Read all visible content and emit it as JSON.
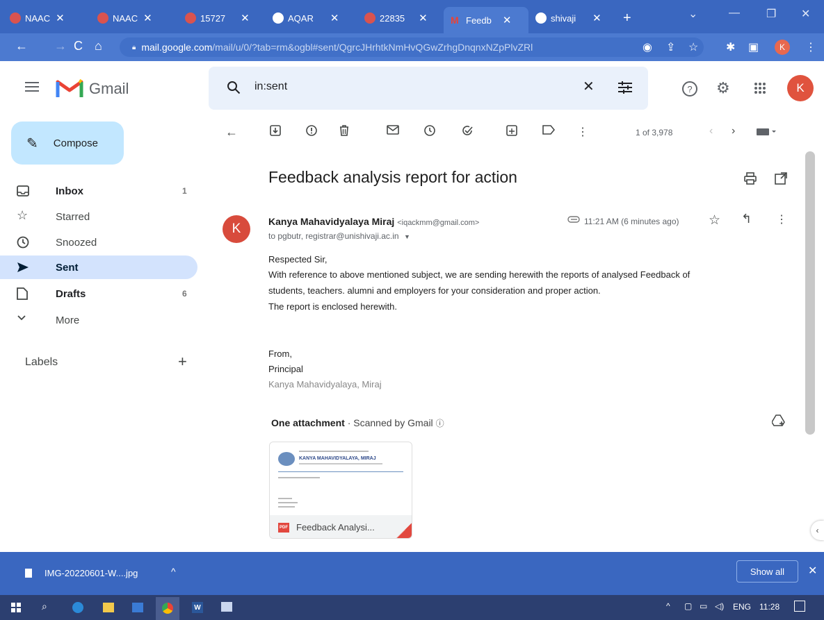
{
  "browser": {
    "tabs": [
      {
        "title": "NAAC",
        "favicon_color": "#d9534f"
      },
      {
        "title": "NAAC",
        "favicon_color": "#d9534f"
      },
      {
        "title": "15727",
        "favicon_color": "#d9534f"
      },
      {
        "title": "AQAR",
        "favicon_color": "#ffffff"
      },
      {
        "title": "22835",
        "favicon_color": "#d9534f"
      },
      {
        "title": "Feedb",
        "favicon_color": "#ea4335",
        "active": true
      },
      {
        "title": "shivaji",
        "favicon_color": "#ffffff"
      }
    ],
    "new_tab_label": "+",
    "url_host": "mail.google.com",
    "url_path": "/mail/u/0/?tab=rm&ogbl#sent/QgrcJHrhtkNmHvQGwZrhgDnqnxNZpPlvZRl",
    "profile_initial": "K",
    "accent": "#3a67c0"
  },
  "gmail": {
    "logo_text": "Gmail",
    "search_value": "in:sent",
    "account_initial": "K",
    "compose_label": "Compose",
    "nav": [
      {
        "label": "Inbox",
        "count": "1",
        "icon": "inbox-icon",
        "bold": true
      },
      {
        "label": "Starred",
        "count": "",
        "icon": "star-icon"
      },
      {
        "label": "Snoozed",
        "count": "",
        "icon": "clock-icon"
      },
      {
        "label": "Sent",
        "count": "",
        "icon": "send-icon",
        "active": true
      },
      {
        "label": "Drafts",
        "count": "6",
        "icon": "draft-icon",
        "bold": true
      },
      {
        "label": "More",
        "count": "",
        "icon": "chevron-down-icon"
      }
    ],
    "labels_heading": "Labels",
    "pager": "1 of 3,978"
  },
  "message": {
    "subject": "Feedback analysis report for action",
    "sender_initial": "K",
    "sender_name": "Kanya Mahavidyalaya Miraj",
    "sender_email": "<iqackmm@gmail.com>",
    "to": "to pgbutr, registrar@unishivaji.ac.in",
    "time": "11:21 AM (6 minutes ago)",
    "body": [
      "Respected Sir,",
      "With reference to above mentioned subject, we are sending herewith the reports of analysed Feedback of",
      "students, teachers. alumni and employers for your consideration and proper action.",
      "The report is enclosed herewith."
    ],
    "signature": [
      "From,",
      "Principal",
      "Kanya Mahavidyalaya, Miraj"
    ],
    "attachment_heading": "One attachment",
    "scanned_text": "Scanned by Gmail",
    "attachment_name": "Feedback Analysi...",
    "attachment_preview_title": "KANYA MAHAVIDYALAYA, MIRAJ",
    "pdf_badge": "PDF"
  },
  "downloads": {
    "file": "IMG-20220601-W....jpg",
    "show_all": "Show all"
  },
  "taskbar": {
    "lang": "ENG",
    "clock": "11:28"
  }
}
